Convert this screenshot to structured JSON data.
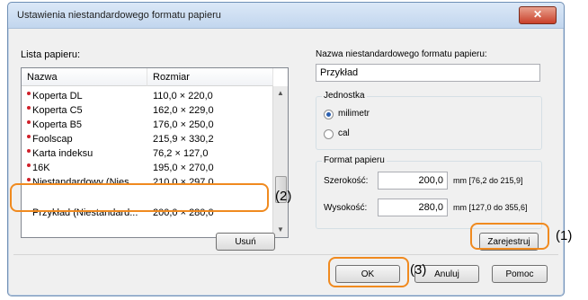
{
  "window": {
    "title": "Ustawienia niestandardowego formatu papieru",
    "close": "✕"
  },
  "list": {
    "label": "Lista papieru:",
    "columns": [
      "Nazwa",
      "Rozmiar"
    ],
    "rows": [
      {
        "name": "Koperta DL",
        "size": "110,0 × 220,0"
      },
      {
        "name": "Koperta C5",
        "size": "162,0 × 229,0"
      },
      {
        "name": "Koperta B5",
        "size": "176,0 × 250,0"
      },
      {
        "name": "Foolscap",
        "size": "215,9 × 330,2"
      },
      {
        "name": "Karta indeksu",
        "size": "76,2 × 127,0"
      },
      {
        "name": "16K",
        "size": "195,0 × 270,0"
      },
      {
        "name": "Niestandardowy (Nies...",
        "size": "210,0 × 297,0"
      }
    ],
    "selected": {
      "name": "Przykład (Niestandard...",
      "size": "200,0 × 280,0"
    }
  },
  "buttons": {
    "delete": "Usuń",
    "register": "Zarejestruj",
    "ok": "OK",
    "cancel": "Anuluj",
    "help": "Pomoc"
  },
  "format_name": {
    "label": "Nazwa niestandardowego formatu papieru:",
    "value": "Przykład"
  },
  "unit": {
    "title": "Jednostka",
    "options": [
      "milimetr",
      "cal"
    ],
    "selected": "milimetr"
  },
  "paper_format": {
    "title": "Format papieru",
    "width_label": "Szerokość:",
    "width_value": "200,0",
    "width_range": "mm [76,2 do 215,9]",
    "height_label": "Wysokość:",
    "height_value": "280,0",
    "height_range": "mm [127,0 do 355,6]"
  },
  "callouts": {
    "c1": "(1)",
    "c2": "(2)",
    "c3": "(3)"
  },
  "colors": {
    "highlight": "#f08a1f",
    "accent": "#2b5fb0"
  }
}
